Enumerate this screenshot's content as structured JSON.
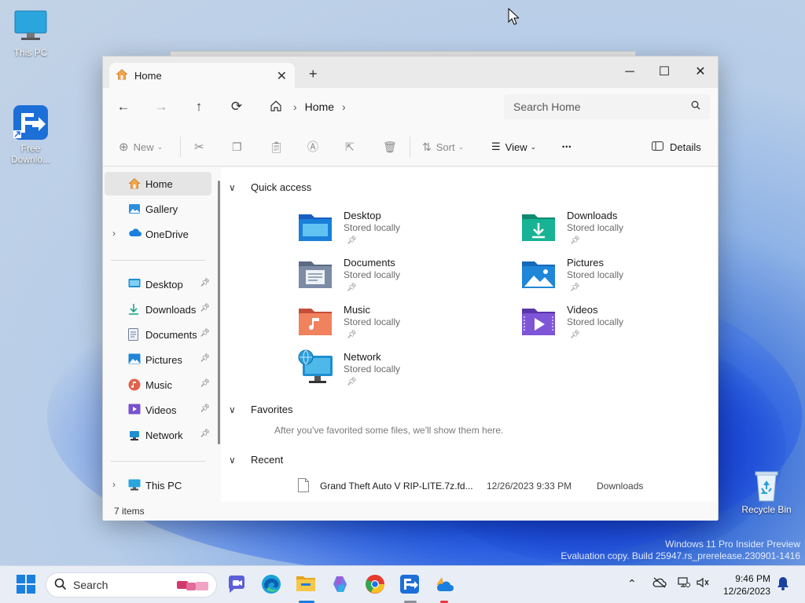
{
  "desktop": {
    "icons": [
      {
        "label": "This PC"
      },
      {
        "label": "Free\nDownlo..."
      },
      {
        "label": "Recycle Bin"
      }
    ],
    "watermark_line1": "Windows 11 Pro Insider Preview",
    "watermark_line2": "Evaluation copy. Build 25947.rs_prerelease.230901-1416"
  },
  "window": {
    "tab_label": "Home",
    "newtab_label": "+",
    "breadcrumb": [
      "Home"
    ],
    "search_placeholder": "Search Home",
    "commands": {
      "new": "New",
      "sort": "Sort",
      "view": "View",
      "more": "•••",
      "details": "Details"
    },
    "sidebar": {
      "top": [
        {
          "label": "Home",
          "selected": true
        },
        {
          "label": "Gallery"
        },
        {
          "label": "OneDrive"
        }
      ],
      "pinned": [
        {
          "label": "Desktop"
        },
        {
          "label": "Downloads"
        },
        {
          "label": "Documents"
        },
        {
          "label": "Pictures"
        },
        {
          "label": "Music"
        },
        {
          "label": "Videos"
        },
        {
          "label": "Network"
        }
      ],
      "bottom": [
        {
          "label": "This PC"
        }
      ]
    },
    "sections": {
      "quick_access": "Quick access",
      "favorites": "Favorites",
      "recent": "Recent"
    },
    "quick_access": [
      {
        "name": "Desktop",
        "sub": "Stored locally",
        "color": "#1a6fd1"
      },
      {
        "name": "Downloads",
        "sub": "Stored locally",
        "color": "#17a78a"
      },
      {
        "name": "Documents",
        "sub": "Stored locally",
        "color": "#6f7f98"
      },
      {
        "name": "Pictures",
        "sub": "Stored locally",
        "color": "#1f86d8"
      },
      {
        "name": "Music",
        "sub": "Stored locally",
        "color": "#e0634e"
      },
      {
        "name": "Videos",
        "sub": "Stored locally",
        "color": "#7a4fd0"
      },
      {
        "name": "Network",
        "sub": "Stored locally",
        "color": "#1e8fd0"
      }
    ],
    "favorites_message": "After you've favorited some files, we'll show them here.",
    "recent": [
      {
        "name": "Grand Theft Auto V RIP-LITE.7z.fd...",
        "date": "12/26/2023 9:33 PM",
        "location": "Downloads"
      }
    ],
    "status": "7 items"
  },
  "taskbar": {
    "search_label": "Search",
    "time": "9:46 PM",
    "date": "12/26/2023"
  }
}
